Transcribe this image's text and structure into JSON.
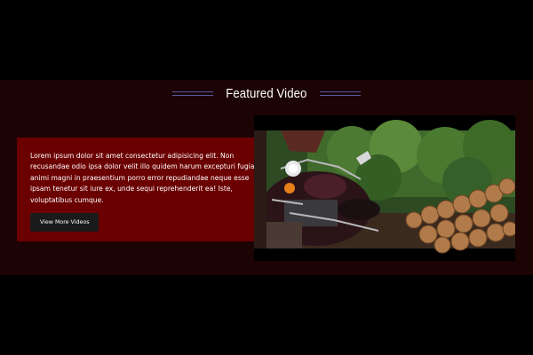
{
  "section": {
    "title": "Featured Video"
  },
  "card": {
    "body": "Lorem ipsum dolor sit amet consectetur adipisicing elit. Non recusandae odio ipsa dolor velit illo quidem harum excepturi fugiat animi magni in praesentium porro error repudiandae neque esse ipsam tenetur sit iure ex, unde sequi reprehenderit ea! Iste, voluptatibus cumque.",
    "button_label": "View More Videos"
  },
  "colors": {
    "page_background": "#000000",
    "section_background": "#1c0304",
    "card_background": "#6b0000",
    "button_background": "#1a1a1a",
    "accent_rule": "#5a5aa0"
  }
}
